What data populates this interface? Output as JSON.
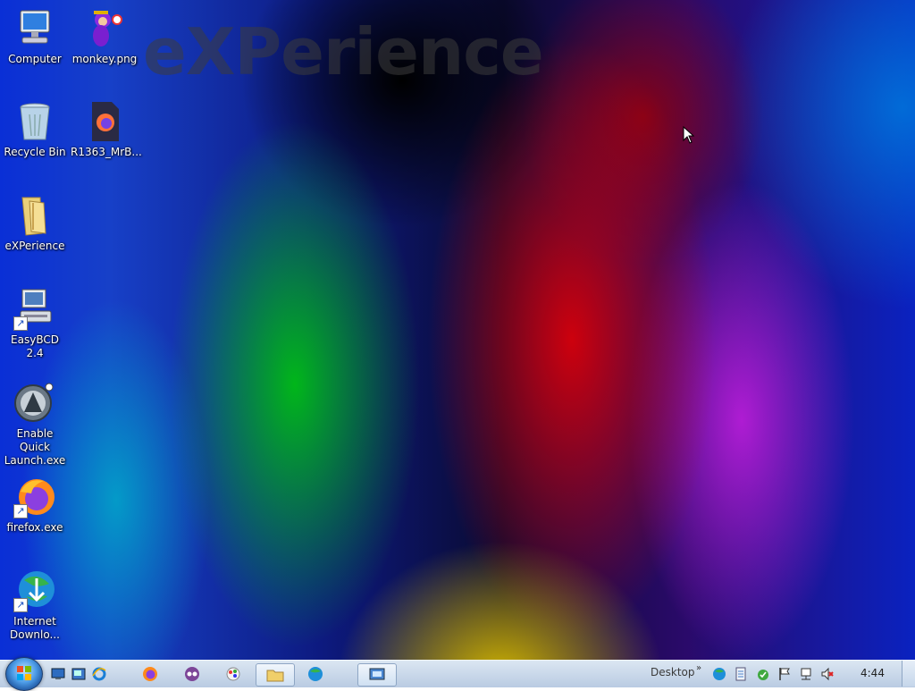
{
  "desktop": {
    "wallpaper_title": "eXPerience",
    "icons": [
      {
        "label": "Computer",
        "icon": "computer-icon"
      },
      {
        "label": "monkey.png",
        "icon": "monkey-image-icon"
      },
      {
        "label": "Recycle Bin",
        "icon": "recycle-bin-icon"
      },
      {
        "label": "R1363_MrB...",
        "icon": "firefox-document-icon"
      },
      {
        "label": "eXPerience",
        "icon": "folder-icon"
      },
      {
        "label": "EasyBCD 2.4",
        "icon": "easybcd-icon"
      },
      {
        "label": "Enable Quick Launch.exe",
        "icon": "quick-launch-exe-icon"
      },
      {
        "label": "firefox.exe",
        "icon": "firefox-icon"
      },
      {
        "label": "Internet Downlo...",
        "icon": "internet-download-manager-icon"
      }
    ]
  },
  "taskbar": {
    "start_icon": "windows-start-orb",
    "quick_launch": [
      "show-desktop-icon",
      "switch-windows-icon",
      "internet-explorer-icon"
    ],
    "pinned": [
      "firefox-icon",
      "tor-browser-icon",
      "color-app-icon",
      "explorer-folder-icon",
      "internet-download-manager-icon",
      "control-panel-icon"
    ],
    "tray_label": "Desktop",
    "tray_chevron": "»",
    "tray_icons": [
      "idm-tray-icon",
      "document-tray-icon",
      "security-tray-icon",
      "action-center-flag-icon",
      "network-icon",
      "volume-muted-icon"
    ],
    "clock": "4:44"
  }
}
